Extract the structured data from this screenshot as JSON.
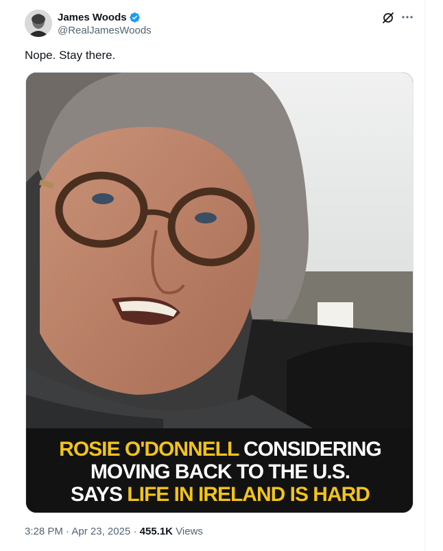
{
  "tweet": {
    "author": {
      "display_name": "James Woods",
      "handle": "@RealJamesWoods",
      "verified": true,
      "verified_color": "#1d9bf0"
    },
    "text": "Nope. Stay there.",
    "media": {
      "caption": {
        "line1_yellow": "ROSIE O'DONNELL",
        "line1_white": " CONSIDERING",
        "line2_white": "MOVING BACK TO THE U.S.",
        "line3_white": "SAYS ",
        "line3_yellow": "LIFE IN IRELAND IS HARD"
      },
      "caption_yellow": "#f2c31a"
    },
    "meta": {
      "time": "3:28 PM",
      "separator": "·",
      "date": "Apr 23, 2025",
      "views_count": "455.1K",
      "views_label": "Views"
    },
    "icons": {
      "grok": "grok-icon",
      "more": "more-icon"
    }
  }
}
